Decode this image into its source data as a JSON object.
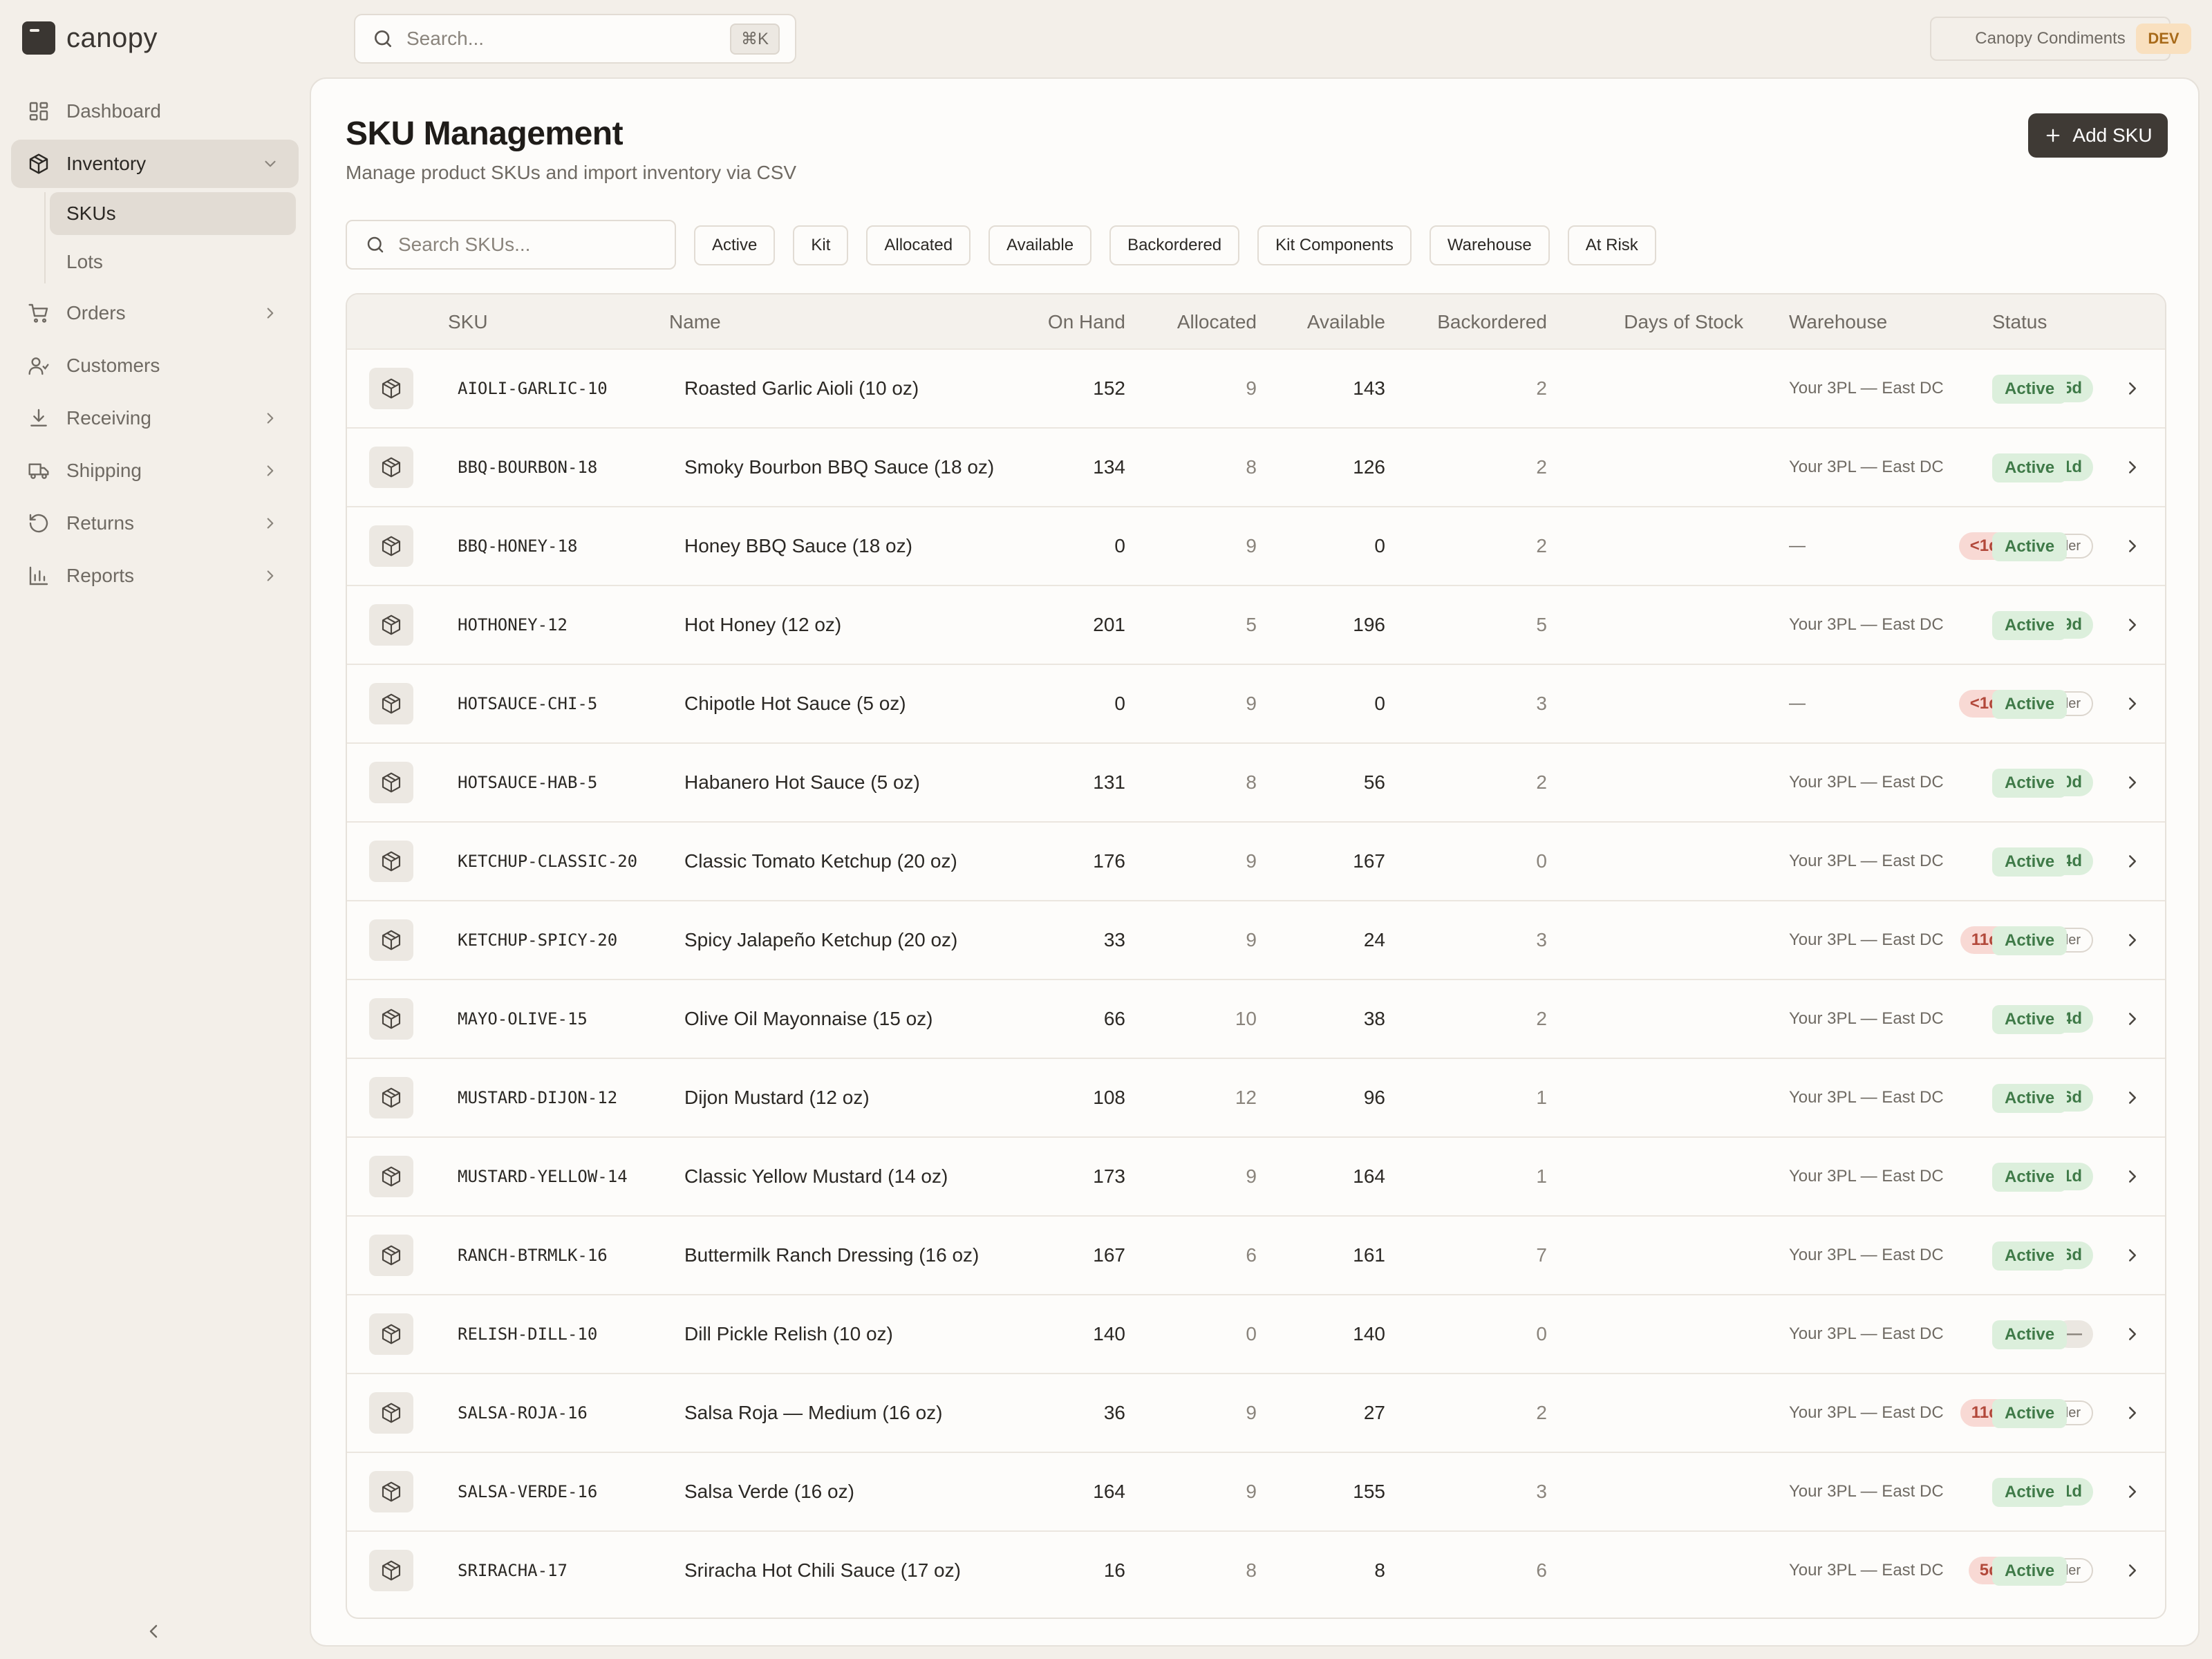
{
  "app": {
    "name": "canopy"
  },
  "search": {
    "placeholder": "Search...",
    "shortcut": "⌘K"
  },
  "org": {
    "name": "Canopy Condiments",
    "env": "DEV"
  },
  "sidebar": {
    "items": [
      {
        "id": "dashboard",
        "label": "Dashboard",
        "icon": "grid-icon",
        "chevron": ""
      },
      {
        "id": "inventory",
        "label": "Inventory",
        "icon": "box-icon",
        "chevron": "down",
        "active": true
      },
      {
        "id": "orders",
        "label": "Orders",
        "icon": "cart-icon",
        "chevron": "right"
      },
      {
        "id": "customers",
        "label": "Customers",
        "icon": "users-icon",
        "chevron": ""
      },
      {
        "id": "receiving",
        "label": "Receiving",
        "icon": "download-icon",
        "chevron": "right"
      },
      {
        "id": "shipping",
        "label": "Shipping",
        "icon": "truck-icon",
        "chevron": "right"
      },
      {
        "id": "returns",
        "label": "Returns",
        "icon": "rotate-ccw-icon",
        "chevron": "right"
      },
      {
        "id": "reports",
        "label": "Reports",
        "icon": "bar-chart-icon",
        "chevron": "right"
      }
    ],
    "inventory_sub": [
      {
        "label": "SKUs",
        "active": true
      },
      {
        "label": "Lots",
        "active": false
      }
    ]
  },
  "page": {
    "title": "SKU Management",
    "subtitle": "Manage product SKUs and import inventory via CSV",
    "add_button": "Add SKU",
    "sku_search_placeholder": "Search SKUs..."
  },
  "filters": [
    "Active",
    "Kit",
    "Allocated",
    "Available",
    "Backordered",
    "Kit Components",
    "Warehouse",
    "At Risk"
  ],
  "table": {
    "columns": [
      "SKU",
      "Name",
      "On Hand",
      "Allocated",
      "Available",
      "Backordered",
      "Days of Stock",
      "Warehouse",
      "Status"
    ],
    "reorder_label": "Reorder",
    "rows": [
      {
        "sku": "AIOLI-GARLIC-10",
        "name": "Roasted Garlic Aioli (10 oz)",
        "on_hand": "152",
        "allocated": "9",
        "available": "143",
        "backordered": "2",
        "days": "45d",
        "days_level": "ok",
        "reorder": false,
        "warehouse": "Your 3PL — East DC",
        "status": "Active"
      },
      {
        "sku": "BBQ-BOURBON-18",
        "name": "Smoky Bourbon BBQ Sauce (18 oz)",
        "on_hand": "134",
        "allocated": "8",
        "available": "126",
        "backordered": "2",
        "days": "51d",
        "days_level": "ok",
        "reorder": false,
        "warehouse": "Your 3PL — East DC",
        "status": "Active"
      },
      {
        "sku": "BBQ-HONEY-18",
        "name": "Honey BBQ Sauce (18 oz)",
        "on_hand": "0",
        "allocated": "9",
        "available": "0",
        "backordered": "2",
        "days": "<1d",
        "days_level": "low",
        "reorder": true,
        "warehouse": "—",
        "status": "Active"
      },
      {
        "sku": "HOTHONEY-12",
        "name": "Hot Honey (12 oz)",
        "on_hand": "201",
        "allocated": "5",
        "available": "196",
        "backordered": "5",
        "days": "69d",
        "days_level": "ok",
        "reorder": false,
        "warehouse": "Your 3PL — East DC",
        "status": "Active"
      },
      {
        "sku": "HOTSAUCE-CHI-5",
        "name": "Chipotle Hot Sauce (5 oz)",
        "on_hand": "0",
        "allocated": "9",
        "available": "0",
        "backordered": "3",
        "days": "<1d",
        "days_level": "low",
        "reorder": true,
        "warehouse": "—",
        "status": "Active"
      },
      {
        "sku": "HOTSAUCE-HAB-5",
        "name": "Habanero Hot Sauce (5 oz)",
        "on_hand": "131",
        "allocated": "8",
        "available": "56",
        "backordered": "2",
        "days": "40d",
        "days_level": "ok",
        "reorder": false,
        "warehouse": "Your 3PL — East DC",
        "status": "Active"
      },
      {
        "sku": "KETCHUP-CLASSIC-20",
        "name": "Classic Tomato Ketchup (20 oz)",
        "on_hand": "176",
        "allocated": "9",
        "available": "167",
        "backordered": "0",
        "days": "64d",
        "days_level": "ok",
        "reorder": false,
        "warehouse": "Your 3PL — East DC",
        "status": "Active"
      },
      {
        "sku": "KETCHUP-SPICY-20",
        "name": "Spicy Jalapeño Ketchup (20 oz)",
        "on_hand": "33",
        "allocated": "9",
        "available": "24",
        "backordered": "3",
        "days": "11d",
        "days_level": "low",
        "reorder": true,
        "warehouse": "Your 3PL — East DC",
        "status": "Active"
      },
      {
        "sku": "MAYO-OLIVE-15",
        "name": "Olive Oil Mayonnaise (15 oz)",
        "on_hand": "66",
        "allocated": "10",
        "available": "38",
        "backordered": "2",
        "days": "24d",
        "days_level": "ok",
        "reorder": false,
        "warehouse": "Your 3PL — East DC",
        "status": "Active"
      },
      {
        "sku": "MUSTARD-DIJON-12",
        "name": "Dijon Mustard (12 oz)",
        "on_hand": "108",
        "allocated": "12",
        "available": "96",
        "backordered": "1",
        "days": "36d",
        "days_level": "ok",
        "reorder": false,
        "warehouse": "Your 3PL — East DC",
        "status": "Active"
      },
      {
        "sku": "MUSTARD-YELLOW-14",
        "name": "Classic Yellow Mustard (14 oz)",
        "on_hand": "173",
        "allocated": "9",
        "available": "164",
        "backordered": "1",
        "days": "61d",
        "days_level": "ok",
        "reorder": false,
        "warehouse": "Your 3PL — East DC",
        "status": "Active"
      },
      {
        "sku": "RANCH-BTRMLK-16",
        "name": "Buttermilk Ranch Dressing (16 oz)",
        "on_hand": "167",
        "allocated": "6",
        "available": "161",
        "backordered": "7",
        "days": "56d",
        "days_level": "ok",
        "reorder": false,
        "warehouse": "Your 3PL — East DC",
        "status": "Active"
      },
      {
        "sku": "RELISH-DILL-10",
        "name": "Dill Pickle Relish (10 oz)",
        "on_hand": "140",
        "allocated": "0",
        "available": "140",
        "backordered": "0",
        "days": "—",
        "days_level": "none",
        "reorder": false,
        "warehouse": "Your 3PL — East DC",
        "status": "Active"
      },
      {
        "sku": "SALSA-ROJA-16",
        "name": "Salsa Roja — Medium (16 oz)",
        "on_hand": "36",
        "allocated": "9",
        "available": "27",
        "backordered": "2",
        "days": "11d",
        "days_level": "low",
        "reorder": true,
        "warehouse": "Your 3PL — East DC",
        "status": "Active"
      },
      {
        "sku": "SALSA-VERDE-16",
        "name": "Salsa Verde (16 oz)",
        "on_hand": "164",
        "allocated": "9",
        "available": "155",
        "backordered": "3",
        "days": "51d",
        "days_level": "ok",
        "reorder": false,
        "warehouse": "Your 3PL — East DC",
        "status": "Active"
      },
      {
        "sku": "SRIRACHA-17",
        "name": "Sriracha Hot Chili Sauce (17 oz)",
        "on_hand": "16",
        "allocated": "8",
        "available": "8",
        "backordered": "6",
        "days": "5d",
        "days_level": "low",
        "reorder": true,
        "warehouse": "Your 3PL — East DC",
        "status": "Active"
      }
    ]
  }
}
